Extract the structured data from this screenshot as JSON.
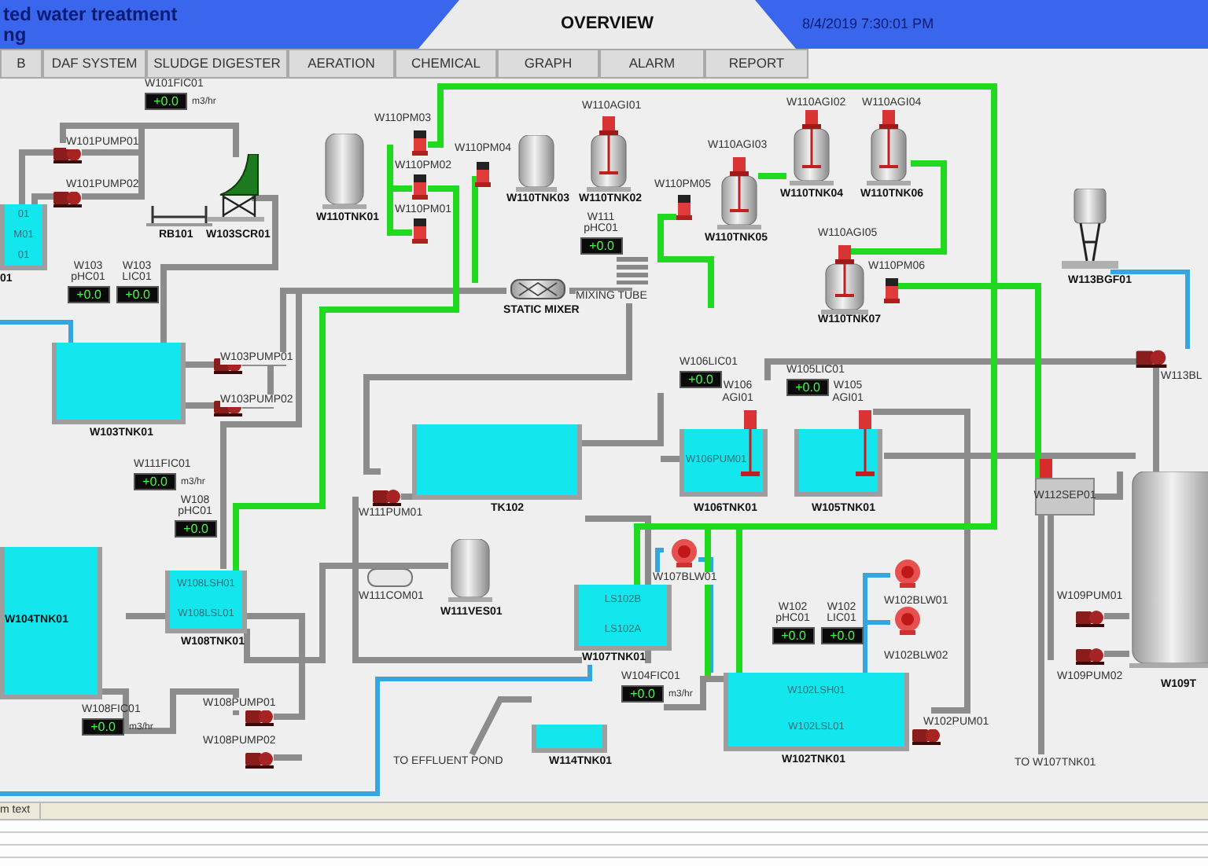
{
  "header": {
    "title": "ted water treatment",
    "subtitle": "ng",
    "screen_title": "OVERVIEW",
    "datetime": "8/4/2019 7:30:01 PM"
  },
  "tabs": [
    {
      "label": "B",
      "selected": false
    },
    {
      "label": "DAF SYSTEM",
      "selected": false
    },
    {
      "label": "SLUDGE DIGESTER",
      "selected": false
    },
    {
      "label": "AERATION",
      "selected": false
    },
    {
      "label": "CHEMICAL",
      "selected": false
    },
    {
      "label": "GRAPH",
      "selected": false
    },
    {
      "label": "ALARM",
      "selected": false
    },
    {
      "label": "REPORT",
      "selected": false
    }
  ],
  "equipment": [
    {
      "kind": "pump",
      "label": "W101PUMP01"
    },
    {
      "kind": "pump",
      "label": "W101PUMP02"
    },
    {
      "kind": "rack",
      "label": "RB101"
    },
    {
      "kind": "screen",
      "label": "W103SCR01"
    },
    {
      "kind": "vessel",
      "label": "W110TNK01"
    },
    {
      "kind": "metering_pump",
      "label": "W110PM03"
    },
    {
      "kind": "metering_pump",
      "label": "W110PM02"
    },
    {
      "kind": "metering_pump",
      "label": "W110PM01"
    },
    {
      "kind": "metering_pump",
      "label": "W110PM04"
    },
    {
      "kind": "vessel",
      "label": "W110TNK03"
    },
    {
      "kind": "agitated_vessel",
      "label": "W110TNK02",
      "agitator": "W110AGI01"
    },
    {
      "kind": "metering_pump",
      "label": "W110PM05"
    },
    {
      "kind": "agitated_vessel",
      "label": "W110TNK05",
      "agitator": "W110AGI03"
    },
    {
      "kind": "agitated_vessel",
      "label": "W110TNK04",
      "agitator": "W110AGI02"
    },
    {
      "kind": "agitated_vessel",
      "label": "W110TNK06",
      "agitator": "W110AGI04"
    },
    {
      "kind": "agitated_vessel",
      "label": "W110TNK07",
      "agitator": "W110AGI05"
    },
    {
      "kind": "metering_pump",
      "label": "W110PM06"
    },
    {
      "kind": "mixer",
      "label": "STATIC MIXER"
    },
    {
      "kind": "mixing_tube",
      "label": "MIXING TUBE"
    },
    {
      "kind": "filter",
      "label": "W113BGF01"
    },
    {
      "kind": "pump",
      "label": "W113BL"
    },
    {
      "kind": "basin",
      "label": "W103TNK01"
    },
    {
      "kind": "pump",
      "label": "W103PUMP01"
    },
    {
      "kind": "pump",
      "label": "W103PUMP02"
    },
    {
      "kind": "basin",
      "label": "TK102"
    },
    {
      "kind": "pump",
      "label": "W111PUM01"
    },
    {
      "kind": "compressor",
      "label": "W111COM01"
    },
    {
      "kind": "vessel",
      "label": "W111VES01"
    },
    {
      "kind": "basin",
      "label": "W108TNK01",
      "inner": [
        "W108LSH01",
        "W108LSL01"
      ]
    },
    {
      "kind": "basin",
      "label": "W104TNK01"
    },
    {
      "kind": "basin",
      "label": "W106TNK01",
      "agitator": "W106 AGI01",
      "inner": [
        "W106PUM01"
      ]
    },
    {
      "kind": "basin",
      "label": "W105TNK01",
      "agitator": "W105 AGI01"
    },
    {
      "kind": "separator",
      "label": "W112SEP01"
    },
    {
      "kind": "blower",
      "label": "W107BLW01"
    },
    {
      "kind": "basin",
      "label": "W107TNK01",
      "inner": [
        "LS102B",
        "LS102A"
      ]
    },
    {
      "kind": "basin",
      "label": "W102TNK01",
      "inner": [
        "W102LSH01",
        "W102LSL01"
      ]
    },
    {
      "kind": "blower",
      "label": "W102BLW01"
    },
    {
      "kind": "blower",
      "label": "W102BLW02"
    },
    {
      "kind": "pump",
      "label": "W109PUM01"
    },
    {
      "kind": "pump",
      "label": "W109PUM02"
    },
    {
      "kind": "vessel",
      "label": "W109T"
    },
    {
      "kind": "pump",
      "label": "W102PUM01"
    },
    {
      "kind": "pump",
      "label": "W108PUMP01"
    },
    {
      "kind": "pump",
      "label": "W108PUMP02"
    },
    {
      "kind": "basin",
      "label": "W114TNK01"
    },
    {
      "kind": "basin",
      "label": "01",
      "inner": [
        "01",
        "M01",
        "01"
      ]
    }
  ],
  "displays": [
    {
      "tag": "W101FIC01",
      "value": "+0.0",
      "unit": "m3/hr"
    },
    {
      "tag": "W103 pHC01",
      "value": "+0.0"
    },
    {
      "tag": "W103 LIC01",
      "value": "+0.0"
    },
    {
      "tag": "W111 pHC01",
      "value": "+0.0"
    },
    {
      "tag": "W111FIC01",
      "value": "+0.0",
      "unit": "m3/hr"
    },
    {
      "tag": "W108 pHC01",
      "value": "+0.0"
    },
    {
      "tag": "W106LIC01",
      "value": "+0.0"
    },
    {
      "tag": "W105LIC01",
      "value": "+0.0"
    },
    {
      "tag": "W102 pHC01",
      "value": "+0.0"
    },
    {
      "tag": "W102 LIC01",
      "value": "+0.0"
    },
    {
      "tag": "W104FIC01",
      "value": "+0.0",
      "unit": "m3/hr"
    },
    {
      "tag": "W108FIC01",
      "value": "+0.0",
      "unit": "m3/hr"
    }
  ],
  "notes": [
    "TO EFFLUENT POND",
    "TO W107TNK01"
  ],
  "alarm_table": {
    "columns": [
      "m text"
    ]
  }
}
